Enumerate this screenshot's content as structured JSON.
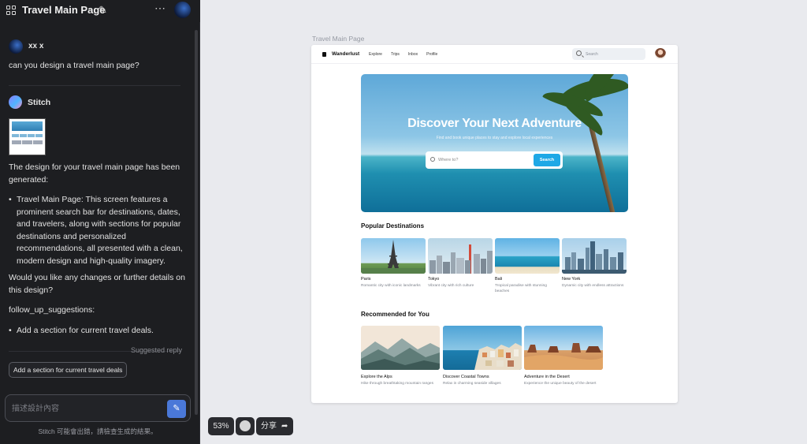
{
  "app": {
    "title": "Travel Main Page"
  },
  "chat": {
    "user": {
      "name": "xx x",
      "message": "can you design a travel main page?"
    },
    "assistant": {
      "name": "Stitch",
      "intro": "The design for your travel main page has been generated:",
      "bullet": "Travel Main Page: This screen features a prominent search bar for destinations, dates, and travelers, along with sections for popular destinations and personalized recommendations, all presented with a clean, modern design and high-quality imagery.",
      "question": "Would you like any changes or further details on this design?",
      "followup_label": "follow_up_suggestions:",
      "followup_item": "Add a section for current travel deals."
    },
    "suggested_label": "Suggested reply",
    "suggestion_chip": "Add a section for current travel deals",
    "input_placeholder": "描述設計內容",
    "disclaimer": "Stitch 可能會出錯，請檢查生成的結果。"
  },
  "canvas": {
    "frame_label": "Travel Main Page",
    "zoom": "53%",
    "share_label": "分享"
  },
  "design": {
    "brand": "Wanderlust",
    "nav_links": [
      "Explore",
      "Trips",
      "Inbox",
      "Profile"
    ],
    "search_placeholder": "Search",
    "hero": {
      "title": "Discover Your Next Adventure",
      "subtitle": "Find and book unique places to stay and explore local experiences",
      "search_placeholder": "Where to?",
      "search_button": "Search"
    },
    "popular_title": "Popular Destinations",
    "destinations": [
      {
        "name": "Paris",
        "desc": "Romantic city with iconic landmarks"
      },
      {
        "name": "Tokyo",
        "desc": "Vibrant city with rich culture"
      },
      {
        "name": "Bali",
        "desc": "Tropical paradise with stunning beaches"
      },
      {
        "name": "New York",
        "desc": "Dynamic city with endless attractions"
      }
    ],
    "recommended_title": "Recommended for You",
    "recommendations": [
      {
        "name": "Explore the Alps",
        "desc": "Hike through breathtaking mountain ranges"
      },
      {
        "name": "Discover Coastal Towns",
        "desc": "Relax in charming seaside villages"
      },
      {
        "name": "Adventure in the Desert",
        "desc": "Experience the unique beauty of the desert"
      }
    ]
  },
  "colors": {
    "panel_bg": "#1d1e21",
    "canvas_bg": "#e9eaee",
    "accent": "#1ea8e6",
    "send_button": "#4a78d8"
  }
}
